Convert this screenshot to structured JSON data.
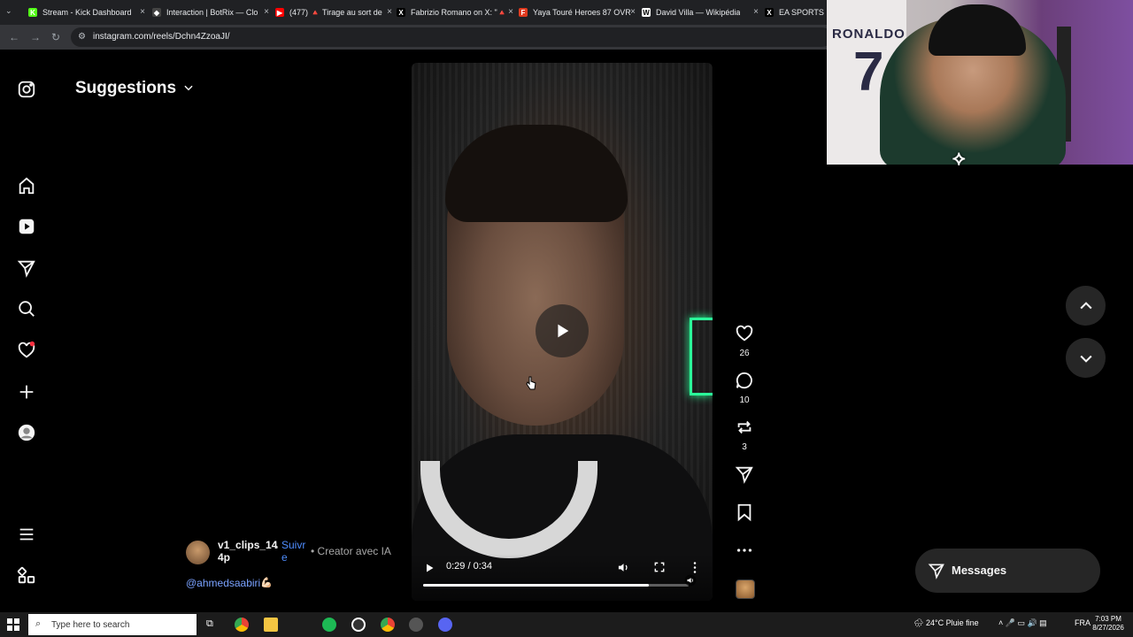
{
  "browser": {
    "tabs": [
      {
        "title": "Stream - Kick Dashboard",
        "favicon_color": "#53fc18",
        "glyph": "K"
      },
      {
        "title": "Interaction | BotRix — Clo",
        "favicon_color": "#444444",
        "glyph": "◆"
      },
      {
        "title": "(477) 🔺 Tirage au sort de",
        "favicon_color": "#ff0000",
        "glyph": "▶"
      },
      {
        "title": "Fabrizio Romano on X: \"🔺",
        "favicon_color": "#000000",
        "glyph": "X"
      },
      {
        "title": "Yaya Touré Heroes 87 OVR",
        "favicon_color": "#e03a1e",
        "glyph": "F"
      },
      {
        "title": "David Villa — Wikipédia",
        "favicon_color": "#ffffff",
        "glyph": "W"
      },
      {
        "title": "EA SPORTS F",
        "favicon_color": "#000000",
        "glyph": "X"
      }
    ],
    "url": "instagram.com/reels/Dchn4ZzoaJI/"
  },
  "sidebar": {
    "items": [
      {
        "name": "instagram-logo-icon"
      },
      {
        "name": "home-icon"
      },
      {
        "name": "reels-icon"
      },
      {
        "name": "direct-icon"
      },
      {
        "name": "search-icon"
      },
      {
        "name": "notifications-icon"
      },
      {
        "name": "create-icon"
      },
      {
        "name": "profile-icon"
      },
      {
        "name": "more-menu-icon"
      },
      {
        "name": "also-from-meta-icon"
      }
    ]
  },
  "header": {
    "title": "Suggestions"
  },
  "reel": {
    "time": "0:29 / 0:34",
    "progress": 0.85,
    "likes": "26",
    "comments": "10",
    "reposts": "3",
    "author": {
      "username": "v1_clips_14 4p",
      "follow_label": "Suivre",
      "separator": "•",
      "tag": "Creator avec IA"
    },
    "caption_mention": "@ahmedsaabiri",
    "caption_emoji": "💪🏻"
  },
  "webcam": {
    "jersey_name": "RONALDO",
    "jersey_number": "7"
  },
  "messages": {
    "label": "Messages"
  },
  "taskbar": {
    "search_placeholder": "Type here to search",
    "weather": "24°C  Pluie fine",
    "language": "FRA",
    "time": "7:03 PM",
    "date": "8/27/2026"
  },
  "colors": {
    "accent": "#4f8dff",
    "notification_dot": "#ff3040",
    "background": "#000000"
  }
}
